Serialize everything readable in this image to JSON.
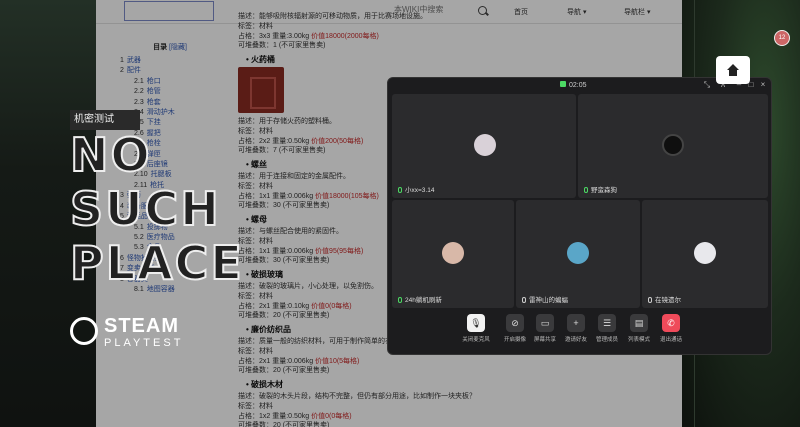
{
  "topbar": {
    "search_placeholder": "本WIKI中搜索",
    "nav_home": "首页",
    "nav_guide": "导航",
    "nav_bar": "导航栏"
  },
  "toc": {
    "title": "目录",
    "hide": "[隐藏]",
    "items": [
      {
        "num": "1",
        "label": "武器",
        "level": 1
      },
      {
        "num": "2",
        "label": "配件",
        "level": 1
      },
      {
        "num": "2.1",
        "label": "枪口",
        "level": 2
      },
      {
        "num": "2.2",
        "label": "枪管",
        "level": 2
      },
      {
        "num": "2.3",
        "label": "枪套",
        "level": 2
      },
      {
        "num": "2.4",
        "label": "滑动护木",
        "level": 2
      },
      {
        "num": "2.5",
        "label": "下挂",
        "level": 2
      },
      {
        "num": "2.6",
        "label": "握把",
        "level": 2
      },
      {
        "num": "2.7",
        "label": "枪栓",
        "level": 2
      },
      {
        "num": "2.8",
        "label": "弹匣",
        "level": 2
      },
      {
        "num": "2.9",
        "label": "后座镜",
        "level": 2
      },
      {
        "num": "2.10",
        "label": "托腮板",
        "level": 2
      },
      {
        "num": "2.11",
        "label": "枪托",
        "level": 2
      },
      {
        "num": "3",
        "label": "弹药",
        "level": 1
      },
      {
        "num": "4",
        "label": "装备服饰",
        "level": 1
      },
      {
        "num": "5",
        "label": "消耗品",
        "level": 1
      },
      {
        "num": "5.1",
        "label": "投掷物",
        "level": 2
      },
      {
        "num": "5.2",
        "label": "医疗物品",
        "level": 2
      },
      {
        "num": "5.3",
        "label": "食品",
        "level": 2
      },
      {
        "num": "6",
        "label": "怪物掉落类",
        "level": 1
      },
      {
        "num": "7",
        "label": "变卖物类",
        "level": 1
      },
      {
        "num": "8",
        "label": "容器类",
        "level": 1
      },
      {
        "num": "8.1",
        "label": "地图容器",
        "level": 2
      }
    ]
  },
  "content": {
    "top_lines": [
      "描述：能够吸附核辐射源的可移动物质，用于比赛场地设施。",
      "标签：材料",
      "占格：3x3 重量:3.00kg",
      "价值18000(2000每格)",
      "可堆叠数：1 (不可家里售卖)"
    ],
    "items": [
      {
        "name": "火药桶",
        "desc": "描述：用于存储火药的塑料桶。",
        "tag": "标签：材料",
        "size": "占格：2x2 重量:0.50kg",
        "value": "价值200(50每格)",
        "stack": "可堆叠数：7 (不可家里售卖)",
        "has_image": true
      },
      {
        "name": "螺丝",
        "desc": "描述：用于连接和固定的金属配件。",
        "tag": "标签：材料",
        "size": "占格：1x1 重量:0.006kg",
        "value": "价值18000(105每格)",
        "stack": "可堆叠数：30 (不可家里售卖)"
      },
      {
        "name": "螺母",
        "desc": "描述：与螺丝配合使用的紧固件。",
        "tag": "标签：材料",
        "size": "占格：1x1 重量:0.006kg",
        "value": "价值95(95每格)",
        "stack": "可堆叠数：30 (不可家里售卖)"
      },
      {
        "name": "破损玻璃",
        "desc": "描述：破裂的玻璃片，小心处理，以免割伤。",
        "tag": "标签：材料",
        "size": "占格：2x1 重量:0.10kg",
        "value": "价值0(0每格)",
        "stack": "可堆叠数：20 (不可家里售卖)"
      },
      {
        "name": "廉价纺织品",
        "desc": "描述：质量一般的纺织材料，可用于制作简单的衣物",
        "tag": "标签：材料",
        "size": "占格：2x1 重量:0.006kg",
        "value": "价值10(5每格)",
        "stack": "可堆叠数：20 (不可家里售卖)"
      },
      {
        "name": "破损木材",
        "desc": "描述：破裂的木头片段，结构不完整，但仍有部分用途，比如制作一块夹板？",
        "tag": "标签：材料",
        "size": "占格：1x2 重量:0.50kg",
        "value": "价值0(0每格)",
        "stack": "可堆叠数：20 (不可家里售卖)"
      }
    ]
  },
  "overlay": {
    "tag": "机密测试",
    "words": [
      "NO",
      "SUCH",
      "PLACE"
    ],
    "steam": "STEAM",
    "steam_sub": "PLAYTEST"
  },
  "call": {
    "time": "02:05",
    "participants": [
      {
        "name": "小xx=3.14",
        "mic": "on"
      },
      {
        "name": "野蛮森狗",
        "mic": "on"
      },
      {
        "name": "24h躺机刷新",
        "mic": "on"
      },
      {
        "name": "雷神山的蝙蝠",
        "mic": "off"
      },
      {
        "name": "在镜遗尔",
        "mic": "off"
      }
    ],
    "controls": [
      {
        "label": "关闭麦克风",
        "icon": "mic-icon",
        "glyph": "🎙",
        "style": "light"
      },
      {
        "label": "开启摄像",
        "icon": "camera-off-icon",
        "glyph": "⊘",
        "style": "dark"
      },
      {
        "label": "屏幕共享",
        "icon": "screen-share-icon",
        "glyph": "▭",
        "style": "dark"
      },
      {
        "label": "邀请好友",
        "icon": "invite-icon",
        "glyph": "+",
        "style": "dark"
      },
      {
        "label": "管理成员",
        "icon": "members-icon",
        "glyph": "☰",
        "style": "dark"
      },
      {
        "label": "列表模式",
        "icon": "list-mode-icon",
        "glyph": "▤",
        "style": "dark"
      },
      {
        "label": "退出通话",
        "icon": "hangup-icon",
        "glyph": "✆",
        "style": "red"
      }
    ]
  },
  "notif": "12"
}
